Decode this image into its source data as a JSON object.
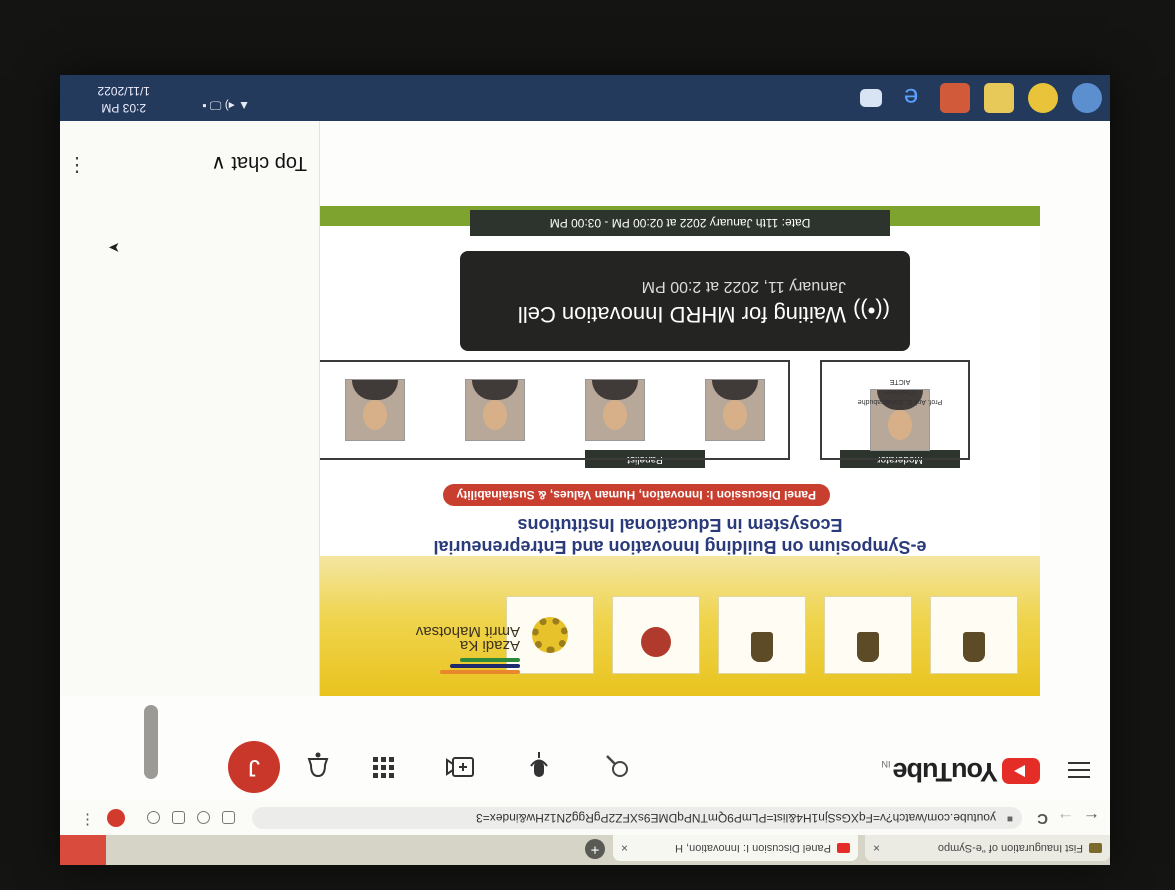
{
  "browser": {
    "tabs": [
      {
        "title": "Fist Inauguration of \"e-Sympo",
        "close": "×"
      },
      {
        "title": "Panel Discusion I: Innovation, H",
        "close": "×"
      }
    ],
    "new_tab": "+",
    "url": "youtube.com/watch?v=FqXGsSjn1H4&list=PLmP9QmTNPqDME9sXFZ2PgRgg2N1zHw&index=3",
    "back": "←",
    "forward": "→",
    "reload": "C",
    "menu": "⋮"
  },
  "youtube": {
    "logo_text": "YouTube",
    "country": "IN",
    "avatar_letter": "J",
    "menu_icon": "hamburger-icon",
    "header_icons": [
      "search-icon",
      "mic-icon",
      "create-video-icon",
      "apps-grid-icon",
      "notifications-bell-icon"
    ]
  },
  "banner": {
    "azadi_line1": "Azadi Ka",
    "azadi_line2": "Amrit Mahotsav",
    "title_line1": "e-Symposium on Building Innovation and Entrepreneurial",
    "title_line2": "Ecosystem in Educational Institutions",
    "panel_pill": "Panel Discussion I: Innovation, Human Values, & Sustainability",
    "moderator_label": "Moderator",
    "panelist_label": "Panelist",
    "moderator_name": "Prof. Anil D. Sahasrabudhe",
    "moderator_role": "Chairman",
    "moderator_org": "AICTE",
    "date_strip": "Date: 11th January 2022 at 02:00 PM - 03:00 PM"
  },
  "waiting": {
    "title": "Waiting for MHRD Innovation Cell",
    "when": "January 11, 2022 at 2:00 PM"
  },
  "chat": {
    "header": "Top chat",
    "chevron": "∨",
    "menu": "⋮"
  },
  "taskbar": {
    "time": "2:03 PM",
    "date": "1/11/2022",
    "tray": "▲ ◂) 🖵 ▪"
  },
  "colors": {
    "youtube_red": "#e52d27",
    "banner_yellow": "#e9c31e",
    "title_blue": "#2a3a7a",
    "pill_red": "#c83f30",
    "taskbar": "#233a5c"
  }
}
